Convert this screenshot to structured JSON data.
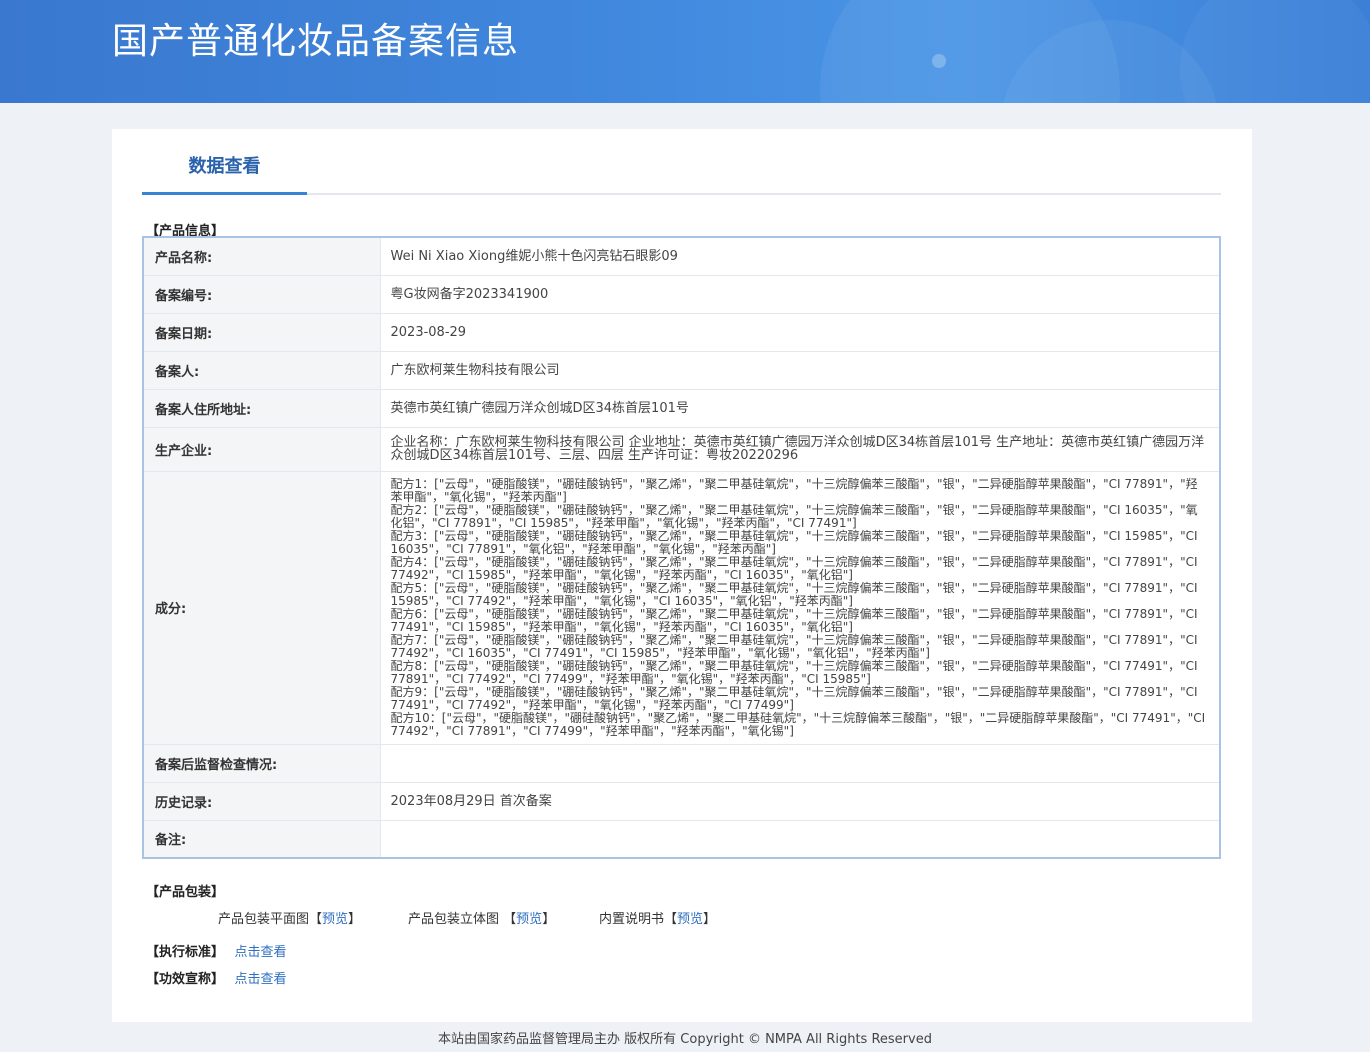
{
  "header": {
    "title": "国产普通化妆品备案信息"
  },
  "tab": {
    "label": "数据查看"
  },
  "product_info": {
    "section_title": "【产品信息】",
    "rows": [
      {
        "key": "产品名称:",
        "value": "Wei Ni Xiao Xiong维妮小熊十色闪亮钻石眼影09"
      },
      {
        "key": "备案编号:",
        "value": "粤G妆网备字2023341900"
      },
      {
        "key": "备案日期:",
        "value": "2023-08-29"
      },
      {
        "key": "备案人:",
        "value": "广东欧柯莱生物科技有限公司"
      },
      {
        "key": "备案人住所地址:",
        "value": "英德市英红镇广德园万洋众创城D区34栋首层101号"
      },
      {
        "key": "生产企业:",
        "value": "企业名称：广东欧柯莱生物科技有限公司 企业地址：英德市英红镇广德园万洋众创城D区34栋首层101号 生产地址：英德市英红镇广德园万洋众创城D区34栋首层101号、三层、四层 生产许可证：粤妆20220296"
      },
      {
        "key": "成分:",
        "value": ""
      },
      {
        "key": "备案后监督检查情况:",
        "value": ""
      },
      {
        "key": "历史记录:",
        "value": "2023年08月29日 首次备案"
      },
      {
        "key": "备注:",
        "value": ""
      }
    ],
    "ingredients": [
      "配方1：[\"云母\"，\"硬脂酸镁\"，\"硼硅酸钠钙\"，\"聚乙烯\"，\"聚二甲基硅氧烷\"，\"十三烷醇偏苯三酸酯\"，\"银\"，\"二异硬脂醇苹果酸酯\"，\"CI 77891\"，\"羟苯甲酯\"，\"氧化锡\"，\"羟苯丙酯\"]",
      "配方2：[\"云母\"，\"硬脂酸镁\"，\"硼硅酸钠钙\"，\"聚乙烯\"，\"聚二甲基硅氧烷\"，\"十三烷醇偏苯三酸酯\"，\"银\"，\"二异硬脂醇苹果酸酯\"，\"CI 16035\"，\"氧化铝\"，\"CI 77891\"，\"CI 15985\"，\"羟苯甲酯\"，\"氧化锡\"，\"羟苯丙酯\"，\"CI 77491\"]",
      "配方3：[\"云母\"，\"硬脂酸镁\"，\"硼硅酸钠钙\"，\"聚乙烯\"，\"聚二甲基硅氧烷\"，\"十三烷醇偏苯三酸酯\"，\"银\"，\"二异硬脂醇苹果酸酯\"，\"CI 15985\"，\"CI 16035\"，\"CI 77891\"，\"氧化铝\"，\"羟苯甲酯\"，\"氧化锡\"，\"羟苯丙酯\"]",
      "配方4：[\"云母\"，\"硬脂酸镁\"，\"硼硅酸钠钙\"，\"聚乙烯\"，\"聚二甲基硅氧烷\"，\"十三烷醇偏苯三酸酯\"，\"银\"，\"二异硬脂醇苹果酸酯\"，\"CI 77891\"，\"CI 77492\"，\"CI 15985\"，\"羟苯甲酯\"，\"氧化锡\"，\"羟苯丙酯\"，\"CI 16035\"，\"氧化铝\"]",
      "配方5：[\"云母\"，\"硬脂酸镁\"，\"硼硅酸钠钙\"，\"聚乙烯\"，\"聚二甲基硅氧烷\"，\"十三烷醇偏苯三酸酯\"，\"银\"，\"二异硬脂醇苹果酸酯\"，\"CI 77891\"，\"CI 15985\"，\"CI 77492\"，\"羟苯甲酯\"，\"氧化锡\"，\"CI 16035\"，\"氧化铝\"，\"羟苯丙酯\"]",
      "配方6：[\"云母\"，\"硬脂酸镁\"，\"硼硅酸钠钙\"，\"聚乙烯\"，\"聚二甲基硅氧烷\"，\"十三烷醇偏苯三酸酯\"，\"银\"，\"二异硬脂醇苹果酸酯\"，\"CI 77891\"，\"CI 77491\"，\"CI 15985\"，\"羟苯甲酯\"，\"氧化锡\"，\"羟苯丙酯\"，\"CI 16035\"，\"氧化铝\"]",
      "配方7：[\"云母\"，\"硬脂酸镁\"，\"硼硅酸钠钙\"，\"聚乙烯\"，\"聚二甲基硅氧烷\"，\"十三烷醇偏苯三酸酯\"，\"银\"，\"二异硬脂醇苹果酸酯\"，\"CI 77891\"，\"CI 77492\"，\"CI 16035\"，\"CI 77491\"，\"CI 15985\"，\"羟苯甲酯\"，\"氧化锡\"，\"氧化铝\"，\"羟苯丙酯\"]",
      "配方8：[\"云母\"，\"硬脂酸镁\"，\"硼硅酸钠钙\"，\"聚乙烯\"，\"聚二甲基硅氧烷\"，\"十三烷醇偏苯三酸酯\"，\"银\"，\"二异硬脂醇苹果酸酯\"，\"CI 77491\"，\"CI 77891\"，\"CI 77492\"，\"CI 77499\"，\"羟苯甲酯\"，\"氧化锡\"，\"羟苯丙酯\"，\"CI 15985\"]",
      "配方9：[\"云母\"，\"硬脂酸镁\"，\"硼硅酸钠钙\"，\"聚乙烯\"，\"聚二甲基硅氧烷\"，\"十三烷醇偏苯三酸酯\"，\"银\"，\"二异硬脂醇苹果酸酯\"，\"CI 77891\"，\"CI 77491\"，\"CI 77492\"，\"羟苯甲酯\"，\"氧化锡\"，\"羟苯丙酯\"，\"CI 77499\"]",
      "配方10：[\"云母\"，\"硬脂酸镁\"，\"硼硅酸钠钙\"，\"聚乙烯\"，\"聚二甲基硅氧烷\"，\"十三烷醇偏苯三酸酯\"，\"银\"，\"二异硬脂醇苹果酸酯\"，\"CI 77491\"，\"CI 77492\"，\"CI 77891\"，\"CI 77499\"，\"羟苯甲酯\"，\"羟苯丙酯\"，\"氧化锡\"]"
    ]
  },
  "packaging": {
    "section_title": "【产品包装】",
    "items": [
      {
        "label": "产品包装平面图",
        "open": "【",
        "link": "预览",
        "close": "】"
      },
      {
        "label": "产品包装立体图",
        "open": "【",
        "link": "预览",
        "close": "】"
      },
      {
        "label": "内置说明书",
        "open": "【",
        "link": "预览",
        "close": "】"
      }
    ]
  },
  "standard": {
    "section_title": "【执行标准】",
    "link": "点击查看"
  },
  "efficacy": {
    "section_title": "【功效宣称】",
    "link": "点击查看"
  },
  "footer": {
    "text": "本站由国家药品监督管理局主办 版权所有 Copyright © NMPA All Rights Reserved"
  },
  "colors": {
    "banner": "#3f86dc",
    "accent": "#2a62ab",
    "link": "#2f6fc0"
  }
}
